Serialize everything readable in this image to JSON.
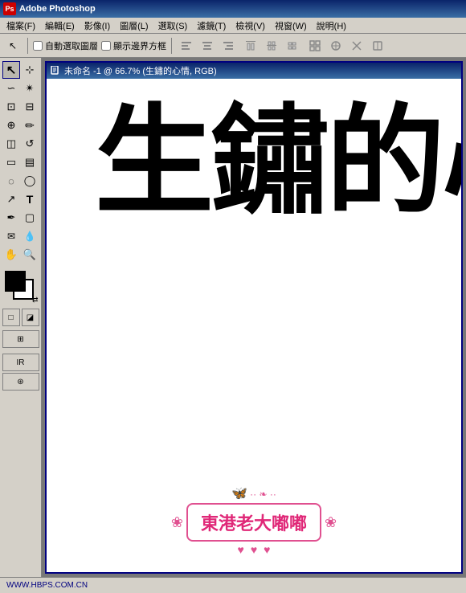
{
  "app": {
    "title": "Adobe Photoshop",
    "icon": "Ps"
  },
  "menubar": {
    "items": [
      "檔案(F)",
      "編輯(E)",
      "影像(I)",
      "圖層(L)",
      "選取(S)",
      "濾鏡(T)",
      "檢視(V)",
      "視窗(W)",
      "說明(H)"
    ]
  },
  "toolbar": {
    "checkboxes": [
      {
        "label": "自動選取圖層",
        "checked": false
      },
      {
        "label": "顯示邊界方框",
        "checked": false
      }
    ]
  },
  "document": {
    "title": "未命名 -1 @ 66.7% (生鏽的心情, RGB)"
  },
  "canvas": {
    "main_text": "生鏽的心情",
    "logo_text": "東港老大嘟嘟"
  },
  "statusbar": {
    "url": "WWW.HBPS.COM.CN"
  },
  "tools": {
    "items": [
      "↖",
      "⊕",
      "✄",
      "✏",
      "⬚",
      "◻",
      "🪣",
      "∆",
      "T",
      "⊘",
      "✋",
      "🔍"
    ]
  }
}
